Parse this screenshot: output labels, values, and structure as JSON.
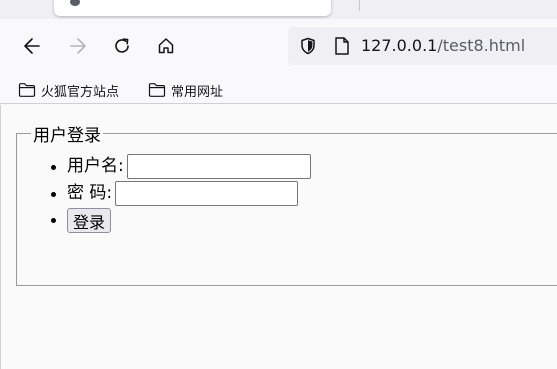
{
  "browser": {
    "url_host": "127.0.0.1",
    "url_path": "/test8.html",
    "back_icon": "back-arrow-icon",
    "forward_icon": "forward-arrow-icon",
    "reload_icon": "reload-icon",
    "home_icon": "home-icon",
    "shield_icon": "tracking-protection-shield-icon",
    "page_icon": "page-info-icon"
  },
  "bookmarks": [
    {
      "label": "火狐官方站点",
      "icon": "folder-icon"
    },
    {
      "label": "常用网址",
      "icon": "folder-icon"
    }
  ],
  "form": {
    "legend": "用户登录",
    "username_label": "用户名:",
    "username_value": "",
    "password_label": "密 码:",
    "password_value": "",
    "submit_label": "登录"
  },
  "colors": {
    "chrome_bg": "#f9f9fb",
    "url_bar_bg": "#f0f0f4",
    "fieldset_border": "#9a9a9a",
    "button_bg": "#e9e9ed"
  }
}
